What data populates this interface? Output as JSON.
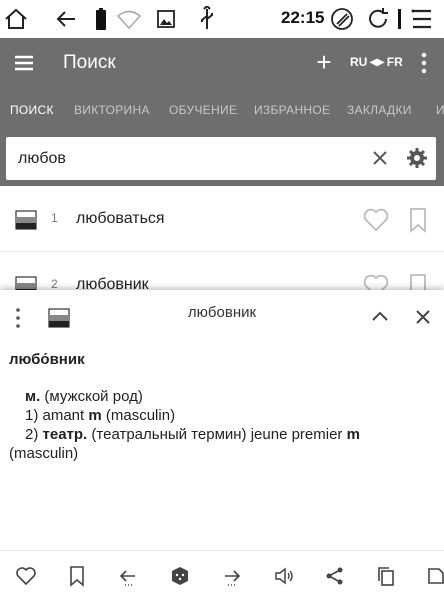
{
  "status_bar": {
    "time": "22:15",
    "icons": [
      "home-icon",
      "back-arrow-icon",
      "battery-icon",
      "wifi-icon",
      "image-icon",
      "usb-icon",
      "broom-icon",
      "refresh-icon",
      "menu-lines-icon"
    ]
  },
  "app_bar": {
    "title": "Поиск",
    "add_icon": "plus-icon",
    "lang_from": "RU",
    "lang_to": "FR",
    "lang_swap_icon": "swap-arrows-icon",
    "overflow_icon": "kebab-menu-icon",
    "background": "#6e6e6e"
  },
  "tabs": [
    {
      "label": "ПОИСК",
      "active": true
    },
    {
      "label": "ВИКТОРИНА",
      "active": false
    },
    {
      "label": "ОБУЧЕНИЕ",
      "active": false
    },
    {
      "label": "ИЗБРАННОЕ",
      "active": false
    },
    {
      "label": "ЗАКЛАДКИ",
      "active": false
    },
    {
      "label": "И",
      "active": false
    }
  ],
  "search": {
    "value": "любов",
    "clear_icon": "close-icon",
    "settings_icon": "gear-icon"
  },
  "results": [
    {
      "number": "1",
      "word": "любоваться"
    },
    {
      "number": "2",
      "word": "любовник"
    }
  ],
  "entry_sheet": {
    "title": "любовник",
    "headword": "любо́вник",
    "lines": {
      "gender_abbr": "м.",
      "gender_text": " (мужской род)",
      "sense1_prefix": "1) amant ",
      "sense1_m": "m",
      "sense1_suffix": " (masculin)",
      "sense2_prefix": "2) ",
      "sense2_label": "театр.",
      "sense2_mid": " (театральный термин) jeune premier ",
      "sense2_m": "m",
      "sense2_suffix": "(masculin)"
    }
  },
  "toolbar": {
    "icons": [
      "heart-icon",
      "bookmark-icon",
      "previous-icon",
      "random-dice-icon",
      "next-icon",
      "speaker-icon",
      "share-icon",
      "copy-icon",
      "edit-icon"
    ]
  }
}
